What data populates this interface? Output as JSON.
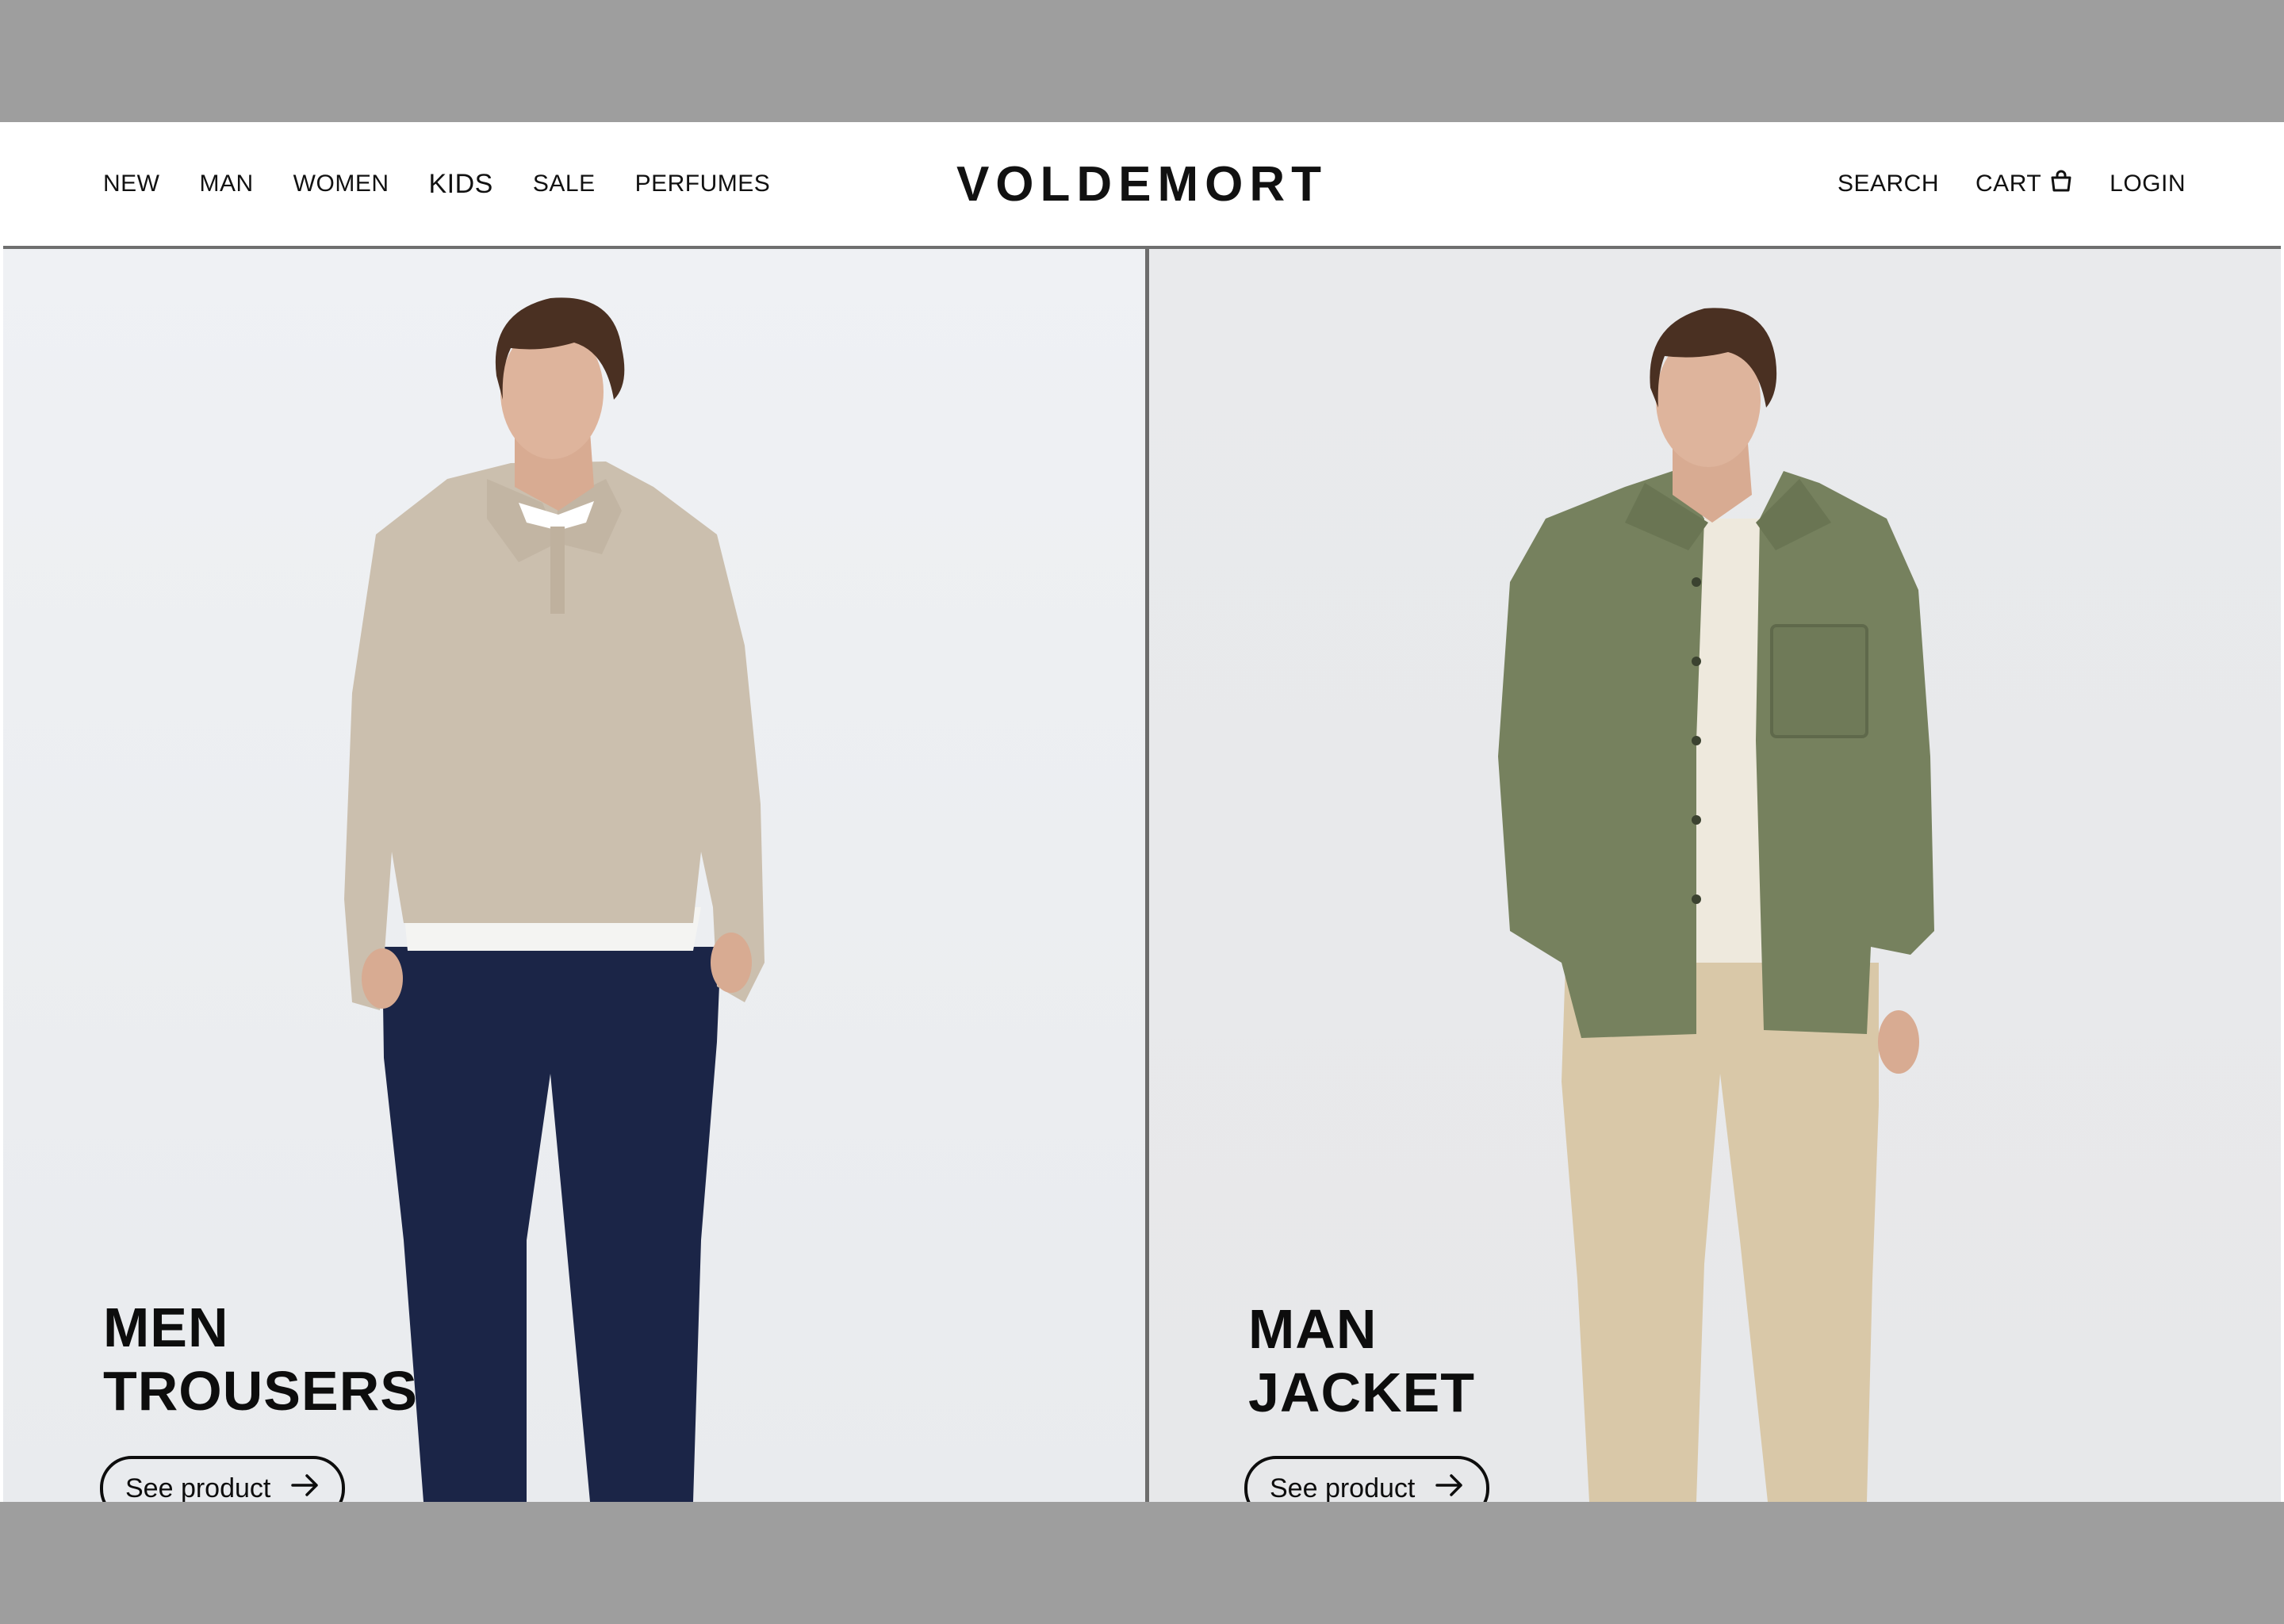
{
  "brand": "VOLDEMORT",
  "nav_left": [
    "NEW",
    "MAN",
    "WOMEN",
    "KIDS",
    "SALE",
    "PERFUMES"
  ],
  "nav_right": {
    "search": "SEARCH",
    "cart": "CART",
    "login": "LOGIN"
  },
  "icons": {
    "cart": "shopping-bag-icon",
    "cta_arrow": "arrow-right-icon"
  },
  "products": [
    {
      "line1": "MEN",
      "line2": "TROUSERS",
      "cta": "See product"
    },
    {
      "line1": "MAN",
      "line2": "JACKET",
      "cta": "See product"
    }
  ],
  "colors": {
    "sweater": "#cbbfae",
    "trousers_navy": "#1b2547",
    "jacket_green": "#76815e",
    "chinos_beige": "#d9c8a8",
    "background_grey": "#9e9e9e"
  }
}
